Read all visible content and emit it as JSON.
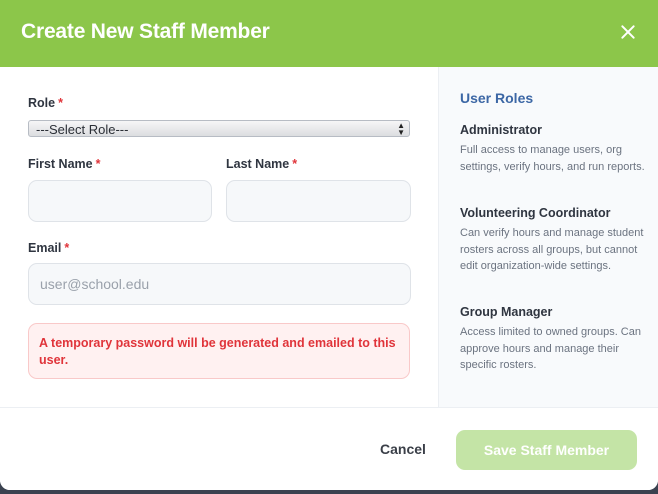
{
  "modal": {
    "title": "Create New Staff Member",
    "close_icon": "close-icon"
  },
  "form": {
    "role_label": "Role",
    "role_selected": "---Select Role---",
    "first_name_label": "First Name",
    "last_name_label": "Last Name",
    "email_label": "Email",
    "email_placeholder": "user@school.edu",
    "required_marker": "*",
    "notice": "A temporary password will be generated and emailed to this user."
  },
  "roles_panel": {
    "title": "User Roles",
    "roles": [
      {
        "name": "Administrator",
        "description": "Full access to manage users, org settings, verify hours, and run reports."
      },
      {
        "name": "Volunteering Coordinator",
        "description": "Can verify hours and manage student rosters across all groups, but cannot edit organization-wide settings."
      },
      {
        "name": "Group Manager",
        "description": "Access limited to owned groups. Can approve hours and manage their specific rosters."
      }
    ]
  },
  "footer": {
    "cancel_label": "Cancel",
    "save_label": "Save Staff Member"
  },
  "colors": {
    "header": "#8cc64a",
    "required": "#e0343a",
    "roles_title": "#3c67a5",
    "save_button": "#c4e4a6"
  }
}
